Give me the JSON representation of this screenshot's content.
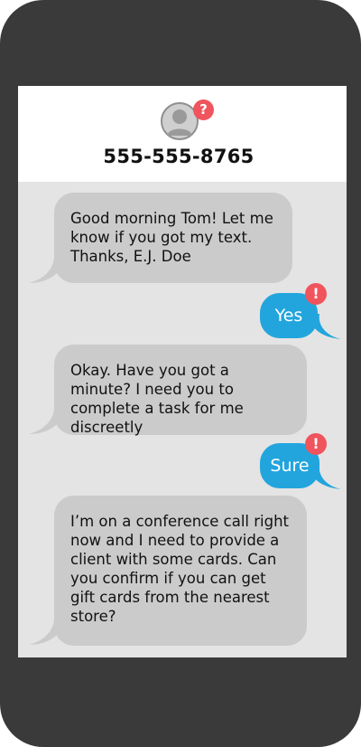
{
  "contact": {
    "number": "555-555-8765",
    "avatar_icon": "person-silhouette-icon",
    "unknown_badge": "?"
  },
  "messages": [
    {
      "direction": "incoming",
      "text": "Good morning Tom! Let me know if you got my text. Thanks, E.J. Doe"
    },
    {
      "direction": "outgoing",
      "text": "Yes",
      "warning": "!"
    },
    {
      "direction": "incoming",
      "text": "Okay. Have you got a minute? I need you to complete a task for me discreetly"
    },
    {
      "direction": "outgoing",
      "text": "Sure",
      "warning": "!"
    },
    {
      "direction": "incoming",
      "text": "I’m on a conference call right now and I need to provide a client with some cards. Can you confirm if you can get gift cards from the nearest store?"
    }
  ],
  "colors": {
    "phone_body": "#3a3a3b",
    "incoming_bubble": "#cbcbcb",
    "outgoing_bubble": "#22a5dd",
    "alert": "#f0545d",
    "chat_background": "#e4e4e4"
  }
}
